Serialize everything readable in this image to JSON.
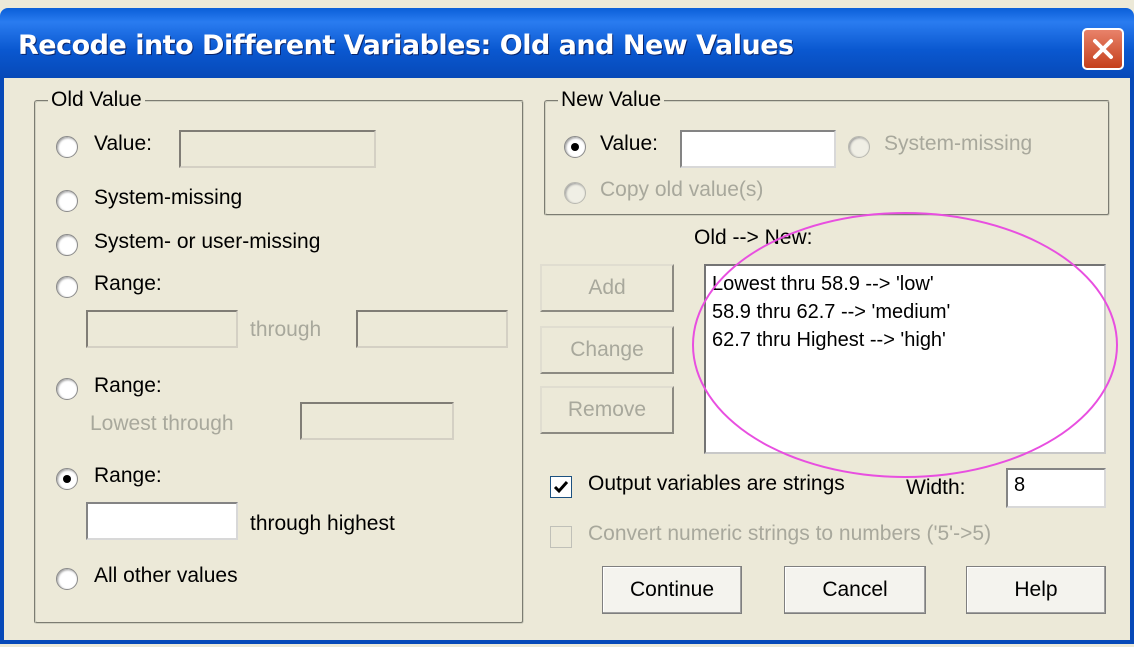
{
  "window": {
    "title": "Recode into Different Variables: Old and New Values"
  },
  "old_value": {
    "legend": "Old Value",
    "value_label": "Value:",
    "system_missing_label": "System-missing",
    "sys_user_missing_label": "System- or user-missing",
    "range1_label": "Range:",
    "through_label": "through",
    "range2_label": "Range:",
    "lowest_through_label": "Lowest through",
    "range3_label": "Range:",
    "through_highest_label": "through highest",
    "all_other_label": "All other values",
    "selected_option": "range3"
  },
  "new_value": {
    "legend": "New Value",
    "value_label": "Value:",
    "value_input": "",
    "system_missing_label": "System-missing",
    "copy_old_label": "Copy old value(s)",
    "selected_option": "value"
  },
  "mapping": {
    "header": "Old --> New:",
    "items": [
      "Lowest thru 58.9 --> 'low'",
      "58.9 thru 62.7 --> 'medium'",
      "62.7 thru Highest --> 'high'"
    ]
  },
  "buttons": {
    "add": "Add",
    "change": "Change",
    "remove": "Remove",
    "continue": "Continue",
    "cancel": "Cancel",
    "help": "Help"
  },
  "options": {
    "output_strings_label": "Output variables are strings",
    "output_strings_checked": true,
    "width_label": "Width:",
    "width_value": "8",
    "convert_numeric_label": "Convert numeric strings to numbers ('5'->5)",
    "convert_numeric_checked": false
  },
  "annotation_color": "#e84fe0"
}
